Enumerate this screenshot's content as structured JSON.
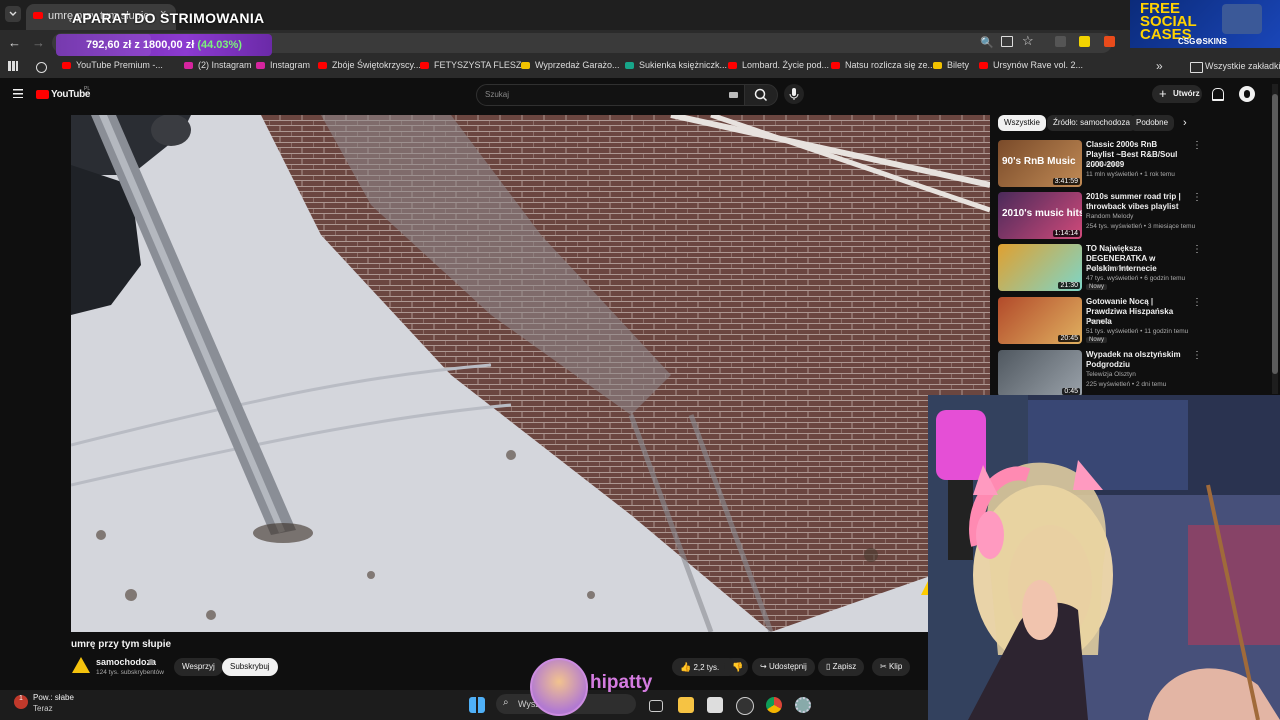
{
  "browser": {
    "tab_title": "umrę przy tym słupie - You...",
    "overlay_title": "APARAT DO STRIMOWANIA",
    "donation": {
      "amount_text": "792,60 zł z 1800,00 zł",
      "percent_text": "(44.03%)",
      "progress": 0.4403
    },
    "bookmarks": [
      {
        "label": "YouTube Premium -...",
        "color": "#ff0000"
      },
      {
        "label": "(2) Instagram",
        "color": "#d6249f"
      },
      {
        "label": "Instagram",
        "color": "#d6249f"
      },
      {
        "label": "Zbóje Świętokrzyscy...",
        "color": "#ff0000"
      },
      {
        "label": "FETYSZYSTA FLESZ...",
        "color": "#ff0000"
      },
      {
        "label": "Wyprzedaż Garażo...",
        "color": "#f2c200"
      },
      {
        "label": "Sukienka księżniczk...",
        "color": "#17a589"
      },
      {
        "label": "Lombard. Życie pod...",
        "color": "#ff0000"
      },
      {
        "label": "Natsu rozlicza się ze...",
        "color": "#ff0000"
      },
      {
        "label": "Bilety",
        "color": "#f2c200"
      },
      {
        "label": "Ursynów Rave vol. 2...",
        "color": "#ff0000"
      }
    ],
    "all_bookmarks": "Wszystkie zakładki"
  },
  "ad": {
    "line1": "FREE",
    "line2": "SOCIAL",
    "line3": "CASES",
    "brand": "CSG⚙SKINS"
  },
  "youtube": {
    "logo": "YouTube",
    "region": "PL",
    "search_placeholder": "Szukaj",
    "create_label": "Utwórz",
    "video": {
      "title": "umrę przy tym słupie",
      "channel": "samochodoza",
      "subscribers": "124 tys. subskrybentów",
      "support_label": "Wesprzyj",
      "subscribe_label": "Subskrybuj",
      "likes": "2,2 tys.",
      "share_label": "Udostępnij",
      "save_label": "Zapisz",
      "clip_label": "Klip"
    },
    "chips": [
      "Wszystkie",
      "Źródło: samochodoza",
      "Podobne"
    ],
    "recommendations": [
      {
        "title": "Classic 2000s RnB Playlist ~Best R&B/Soul 2000-2009",
        "channel": "R & B Music",
        "meta": "11 mln wyświetleń • 1 rok temu",
        "duration": "3:41:59",
        "badge": "",
        "thumb_text": "90's RnB Music"
      },
      {
        "title": "2010s summer road trip | throwback vibes playlist",
        "channel": "Random Melody",
        "meta": "254 tys. wyświetleń • 3 miesiące temu",
        "duration": "1:14:14",
        "badge": "",
        "thumb_text": "2010's music hits"
      },
      {
        "title": "TO Największa DEGENERATKA w Polskim Internecie",
        "channel": "Świat Internetu",
        "meta": "47 tys. wyświetleń • 6 godzin temu",
        "duration": "21:30",
        "badge": "Nowy",
        "thumb_text": ""
      },
      {
        "title": "Gotowanie Nocą | Prawdziwa Hiszpańska Panela",
        "channel": "Pronosz",
        "meta": "51 tys. wyświetleń • 11 godzin temu",
        "duration": "20:45",
        "badge": "Nowy",
        "thumb_text": ""
      },
      {
        "title": "Wypadek na olsztyńskim Podgrodziu",
        "channel": "Telewizja Olsztyn",
        "meta": "225 wyświetleń • 2 dni temu",
        "duration": "0:45",
        "badge": "",
        "thumb_text": ""
      }
    ]
  },
  "taskbar": {
    "weather_title": "Pow.: słabe",
    "weather_sub": "Teraz",
    "weather_badge": "1",
    "search_text": "Wysz",
    "streamer": "hipatty"
  }
}
